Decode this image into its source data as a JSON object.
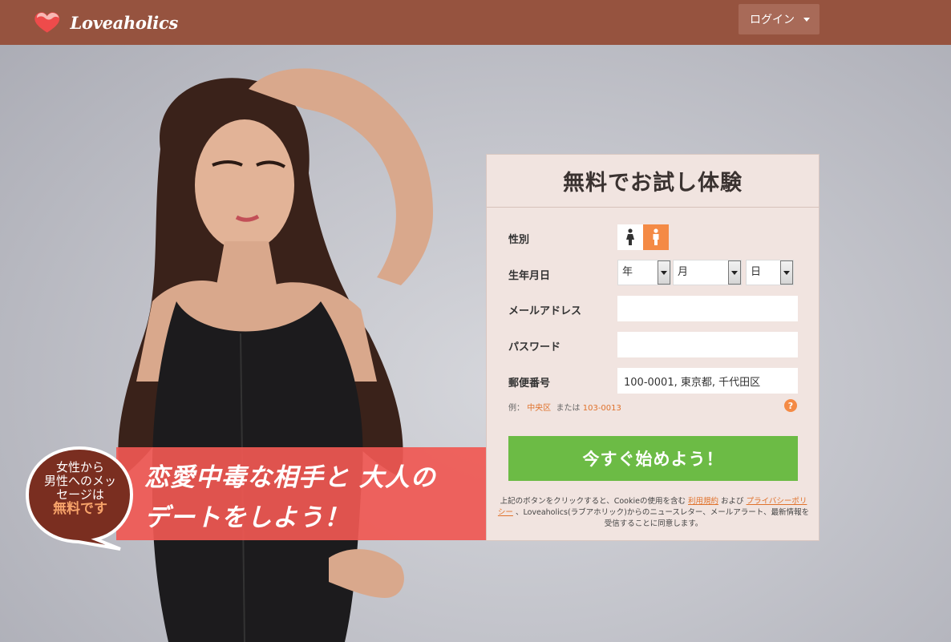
{
  "header": {
    "logo_text": "Loveaholics",
    "login_label": "ログイン"
  },
  "banner": {
    "line1": "恋愛中毒な相手と 大人の",
    "line2": "デートをしよう！"
  },
  "bubble": {
    "line1": "女性から",
    "line2": "男性へのメッ",
    "line3": "セージは",
    "line4": "無料です"
  },
  "form": {
    "title": "無料でお試し体験",
    "gender_label": "性別",
    "birthday_label": "生年月日",
    "year_value": "年",
    "month_value": "月",
    "day_value": "日",
    "email_label": "メールアドレス",
    "email_value": "",
    "password_label": "パスワード",
    "password_value": "",
    "postal_label": "郵便番号",
    "postal_value": "100-0001, 東京都, 千代田区",
    "example_prefix": "例：",
    "example_area": "中央区",
    "example_or": "または",
    "example_code": "103-0013",
    "help_glyph": "?",
    "submit_label": "今すぐ始めよう！",
    "legal_1": "上記のボタンをクリックすると、Cookieの使用を含む",
    "legal_terms": "利用規約",
    "legal_2": "および",
    "legal_privacy": "プライバシーポリシー",
    "legal_3": "、Loveaholics(ラブアホリック)からのニュースレター、メールアラート、最新情報を受信することに同意します。"
  },
  "colors": {
    "header_bg": "#96533f",
    "accent_orange": "#f48a45",
    "cta_green": "#6cbb45",
    "banner_red": "#f05852"
  },
  "icons": [
    "heart-logo-icon",
    "chevron-down-icon",
    "female-icon",
    "male-icon",
    "help-icon"
  ]
}
